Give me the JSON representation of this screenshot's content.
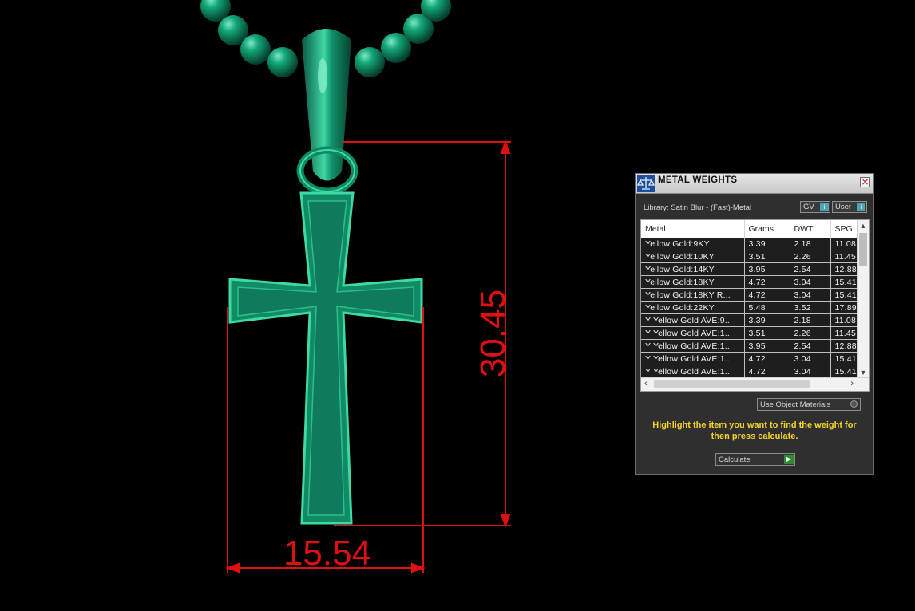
{
  "dimensions": {
    "height_value": "30.45",
    "width_value": "15.54"
  },
  "colors": {
    "model": "#0f7a5c",
    "dimension": "#e01010",
    "instruction": "#f5d22a"
  },
  "panel": {
    "title": "METAL WEIGHTS",
    "close_icon": "×",
    "library_label": "Library: Satin Blur - (Fast)-Metal",
    "toggle_gv": "GV",
    "toggle_user": "User",
    "toggle_icon": "i",
    "columns": [
      "Metal",
      "Grams",
      "DWT",
      "SPG"
    ],
    "rows": [
      [
        "Yellow Gold:9KY",
        "3.39",
        "2.18",
        "11.08"
      ],
      [
        "Yellow Gold:10KY",
        "3.51",
        "2.26",
        "11.45"
      ],
      [
        "Yellow Gold:14KY",
        "3.95",
        "2.54",
        "12.88"
      ],
      [
        "Yellow Gold:18KY",
        "4.72",
        "3.04",
        "15.41"
      ],
      [
        "Yellow Gold:18KY R...",
        "4.72",
        "3.04",
        "15.41"
      ],
      [
        "Yellow Gold:22KY",
        "5.48",
        "3.52",
        "17.89"
      ],
      [
        "Y Yellow Gold AVE:9...",
        "3.39",
        "2.18",
        "11.08"
      ],
      [
        "Y Yellow Gold AVE:1...",
        "3.51",
        "2.26",
        "11.45"
      ],
      [
        "Y Yellow Gold AVE:1...",
        "3.95",
        "2.54",
        "12.88"
      ],
      [
        "Y Yellow Gold AVE:1...",
        "4.72",
        "3.04",
        "15.41"
      ],
      [
        "Y Yellow Gold AVE:1...",
        "4.72",
        "3.04",
        "15.41"
      ]
    ],
    "use_object_materials": "Use Object Materials",
    "instruction": "Highlight the item you want to find the weight for then press calculate.",
    "calculate": "Calculate"
  }
}
